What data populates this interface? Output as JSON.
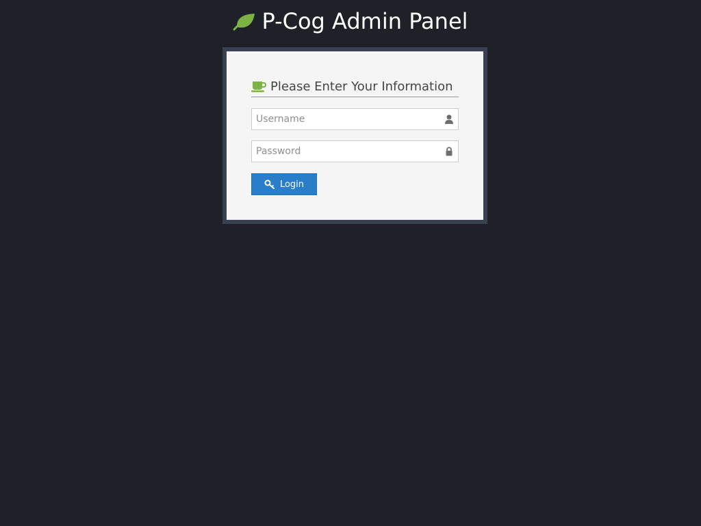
{
  "header": {
    "title": "P-Cog Admin Panel",
    "icon": "leaf-icon"
  },
  "login_panel": {
    "heading": "Please Enter Your Information",
    "heading_icon": "coffee-cup-icon",
    "username": {
      "placeholder": "Username",
      "value": "",
      "icon": "user-icon"
    },
    "password": {
      "placeholder": "Password",
      "value": "",
      "icon": "lock-icon"
    },
    "login_button": {
      "label": "Login",
      "icon": "key-icon"
    }
  },
  "colors": {
    "background": "#1e2127",
    "frame": "#384152",
    "panel": "#f5f5f5",
    "accent_green": "#7cb342",
    "button_blue": "#2a7ec9"
  }
}
